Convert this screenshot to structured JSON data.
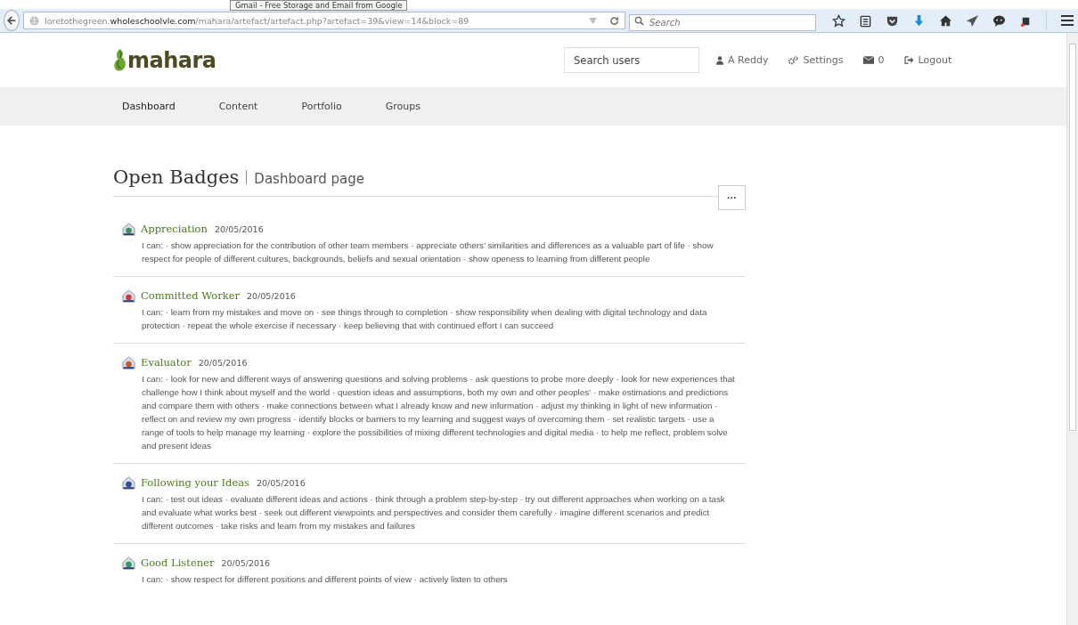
{
  "browser": {
    "tooltip": "Gmail - Free Storage and Email from Google",
    "url": {
      "host_prefix": "loretothegreen.",
      "host_domain": "wholeschoolvle.com",
      "path": "/mahara/artefact/artefact.php?artefact=39&view=14&block=89"
    },
    "search": {
      "placeholder": "Search"
    }
  },
  "header": {
    "logo": "mahara",
    "search": {
      "placeholder": "Search users"
    },
    "user": "A Reddy",
    "settings": "Settings",
    "messages": "0",
    "logout": "Logout"
  },
  "nav": [
    {
      "label": "Dashboard",
      "selected": true
    },
    {
      "label": "Content",
      "selected": false
    },
    {
      "label": "Portfolio",
      "selected": false
    },
    {
      "label": "Groups",
      "selected": false
    }
  ],
  "page": {
    "title": "Open Badges",
    "subtitle": "Dashboard page",
    "menu_button": "···"
  },
  "badges": [
    {
      "name": "Appreciation",
      "date": "20/05/2016",
      "color": "#3f8f5f",
      "description": "I can: · show appreciation for the contribution of other team members · appreciate others’ similarities and differences as a valuable part of life · show respect for people of different cultures, backgrounds, beliefs and sexual orientation · show openess to learning from different people"
    },
    {
      "name": "Committed Worker",
      "date": "20/05/2016",
      "color": "#d03a3a",
      "description": "I can: · learn from my mistakes and move on · see things through to completion · show responsibility when dealing with digital technology and data protection · repeat the whole exercise if necessary · keep believing that with continued effort I can succeed"
    },
    {
      "name": "Evaluator",
      "date": "20/05/2016",
      "color": "#c8582e",
      "description": "I can: · look for new and different ways of answering questions and solving problems · ask questions to probe more deeply · look for new experiences that challenge how I think about myself and the world · question ideas and assumptions, both my own and other peoples’ · make estimations and predictions and compare them with others · make connections between what I already know and new information · adjust my thinking in light of new information · reflect on and review my own progress · identify blocks or barriers to my learning and suggest ways of overcoming them · set realistic targets · use a range of tools to help manage my learning · explore the possibilities of mixing different technologies and digital media · to help me reflect, problem solve and present ideas"
    },
    {
      "name": "Following your Ideas",
      "date": "20/05/2016",
      "color": "#2f4f9a",
      "description": "I can: · test out ideas · evaluate different ideas and actions · think through a problem step-by-step · try out different approaches when working on a task and evaluate what works best · seek out different viewpoints and perspectives and consider them carefully · imagine different scenarios and predict different outcomes · take risks and learn from my mistakes and failures"
    },
    {
      "name": "Good Listener",
      "date": "20/05/2016",
      "color": "#2e9a6a",
      "description": "I can: · show respect for different positions and different points of view · actively listen to others"
    }
  ]
}
